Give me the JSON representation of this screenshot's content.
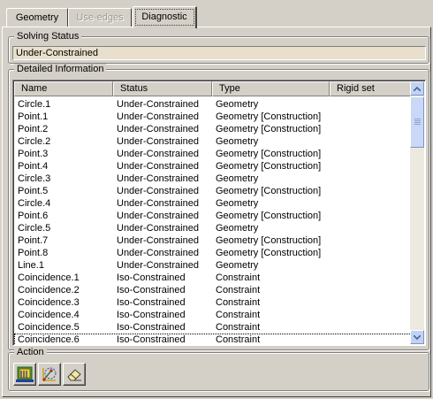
{
  "tabs": [
    {
      "label": "Geometry",
      "state": "normal"
    },
    {
      "label": "Use-edges",
      "state": "disabled"
    },
    {
      "label": "Diagnostic",
      "state": "active"
    }
  ],
  "solving_status": {
    "title": "Solving Status",
    "value": "Under-Constrained"
  },
  "detailed_information": {
    "title": "Detailed Information",
    "columns": [
      "Name",
      "Status",
      "Type",
      "Rigid set"
    ],
    "rows": [
      {
        "name": "Circle.1",
        "status": "Under-Constrained",
        "type": "Geometry",
        "rigid": ""
      },
      {
        "name": "Point.1",
        "status": "Under-Constrained",
        "type": "Geometry [Construction]",
        "rigid": ""
      },
      {
        "name": "Point.2",
        "status": "Under-Constrained",
        "type": "Geometry [Construction]",
        "rigid": ""
      },
      {
        "name": "Circle.2",
        "status": "Under-Constrained",
        "type": "Geometry",
        "rigid": ""
      },
      {
        "name": "Point.3",
        "status": "Under-Constrained",
        "type": "Geometry [Construction]",
        "rigid": ""
      },
      {
        "name": "Point.4",
        "status": "Under-Constrained",
        "type": "Geometry [Construction]",
        "rigid": ""
      },
      {
        "name": "Circle.3",
        "status": "Under-Constrained",
        "type": "Geometry",
        "rigid": ""
      },
      {
        "name": "Point.5",
        "status": "Under-Constrained",
        "type": "Geometry [Construction]",
        "rigid": ""
      },
      {
        "name": "Circle.4",
        "status": "Under-Constrained",
        "type": "Geometry",
        "rigid": ""
      },
      {
        "name": "Point.6",
        "status": "Under-Constrained",
        "type": "Geometry [Construction]",
        "rigid": ""
      },
      {
        "name": "Circle.5",
        "status": "Under-Constrained",
        "type": "Geometry",
        "rigid": ""
      },
      {
        "name": "Point.7",
        "status": "Under-Constrained",
        "type": "Geometry [Construction]",
        "rigid": ""
      },
      {
        "name": "Point.8",
        "status": "Under-Constrained",
        "type": "Geometry [Construction]",
        "rigid": ""
      },
      {
        "name": "Line.1",
        "status": "Under-Constrained",
        "type": "Geometry",
        "rigid": ""
      },
      {
        "name": "Coincidence.1",
        "status": "Iso-Constrained",
        "type": "Constraint",
        "rigid": ""
      },
      {
        "name": "Coincidence.2",
        "status": "Iso-Constrained",
        "type": "Constraint",
        "rigid": ""
      },
      {
        "name": "Coincidence.3",
        "status": "Iso-Constrained",
        "type": "Constraint",
        "rigid": ""
      },
      {
        "name": "Coincidence.4",
        "status": "Iso-Constrained",
        "type": "Constraint",
        "rigid": ""
      },
      {
        "name": "Coincidence.5",
        "status": "Iso-Constrained",
        "type": "Constraint",
        "rigid": ""
      },
      {
        "name": "Coincidence.6",
        "status": "Iso-Constrained",
        "type": "Constraint",
        "rigid": ""
      }
    ]
  },
  "action": {
    "title": "Action",
    "buttons": [
      {
        "icon": "select-elements-icon"
      },
      {
        "icon": "multi-select-icon"
      },
      {
        "icon": "eraser-icon"
      }
    ]
  },
  "colors": {
    "dialog_bg": "#d4d0c8",
    "status_field_bg": "#e8e0cc",
    "scrollbar_blue": "#c1d3f5"
  }
}
